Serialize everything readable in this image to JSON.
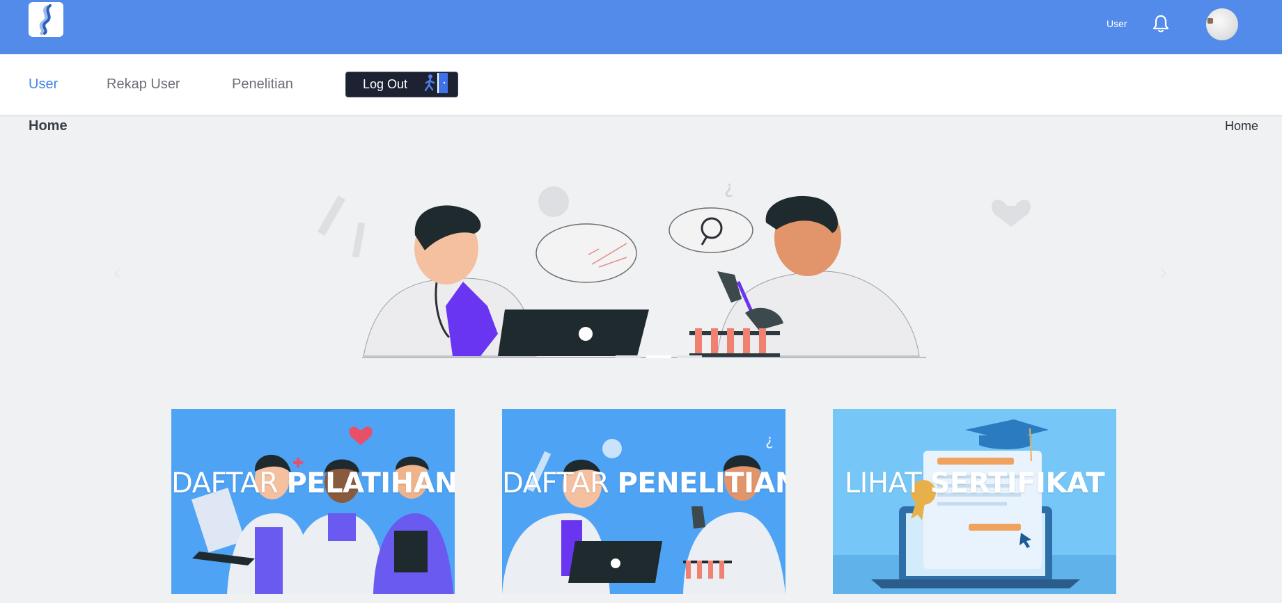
{
  "header": {
    "user_label": "User",
    "icons": [
      "app-logo-icon",
      "bell-icon",
      "avatar"
    ]
  },
  "nav": {
    "items": [
      {
        "label": "User",
        "active": true
      },
      {
        "label": "Rekap User",
        "active": false
      },
      {
        "label": "Penelitian",
        "active": false
      }
    ],
    "logout_label": "Log Out"
  },
  "breadcrumb": {
    "title": "Home",
    "current": "Home"
  },
  "carousel": {
    "prev_glyph": "‹",
    "next_glyph": "›",
    "slide_count": 3,
    "active_slide": 2
  },
  "cards": [
    {
      "word1": "DAFTAR",
      "word2": "PELATIHAN"
    },
    {
      "word1": "DAFTAR",
      "word2": "PENELITIAN"
    },
    {
      "word1": "LIHAT",
      "word2": "SERTIFIKAT"
    }
  ],
  "colors": {
    "header_bg": "#528bea",
    "active_nav": "#3f86e8",
    "logout_bg": "#1d2233",
    "card_bg": "#4ea3f5",
    "card_bg_alt": "#76c7f8"
  }
}
